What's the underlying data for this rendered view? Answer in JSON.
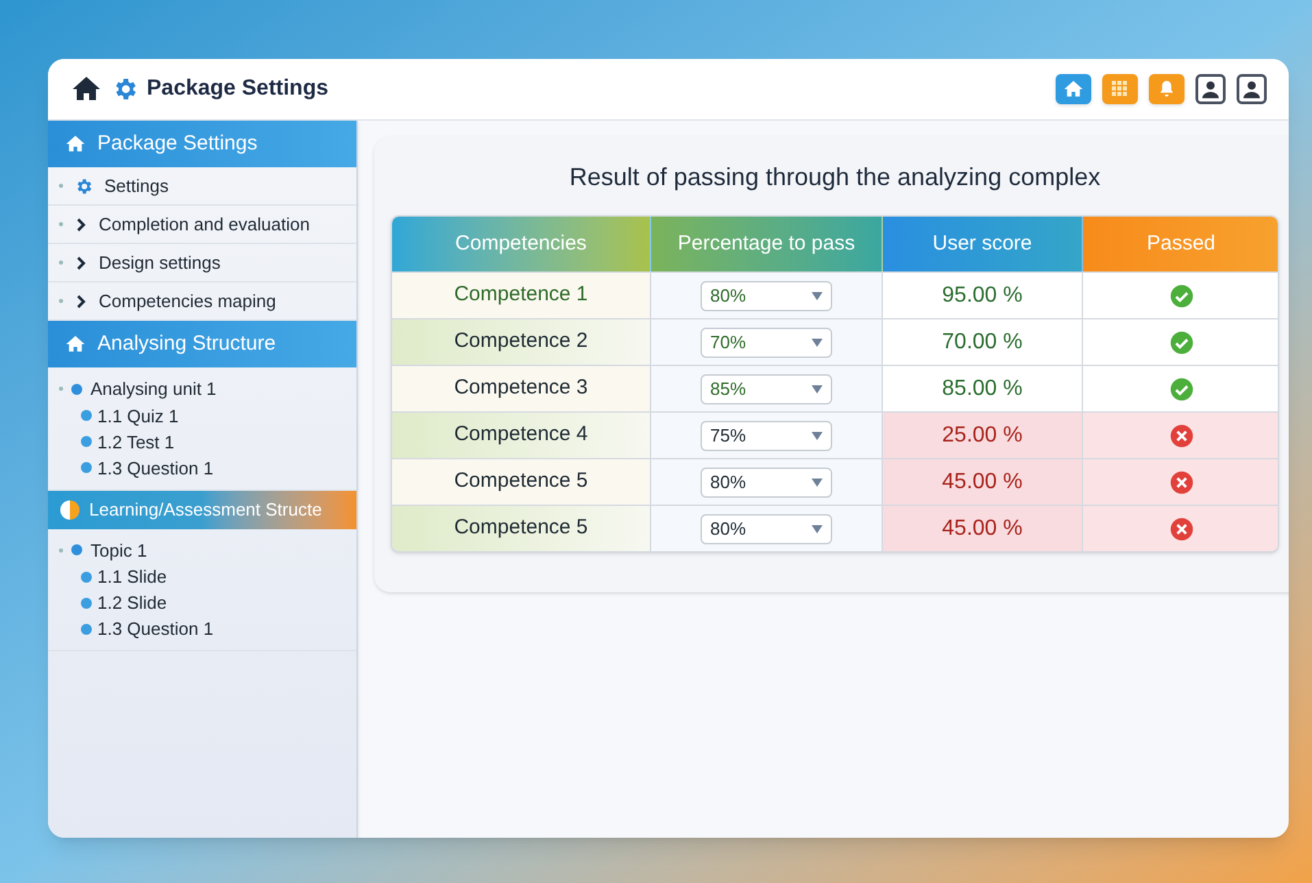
{
  "window": {
    "title": "Package Settings"
  },
  "toolbar": [
    {
      "kind": "home"
    },
    {
      "kind": "grid"
    },
    {
      "kind": "bell"
    },
    {
      "kind": "user"
    },
    {
      "kind": "user"
    }
  ],
  "sidebar": {
    "sections": [
      {
        "title": "Package Settings",
        "kind": "home",
        "items": [
          {
            "label": "Settings",
            "kind": "settings"
          },
          {
            "label": "Completion and evaluation",
            "kind": "chevron"
          },
          {
            "label": "Design settings",
            "kind": "chevron"
          },
          {
            "label": "Competencies maping",
            "kind": "chevron"
          }
        ]
      },
      {
        "title": "Analysing Structure",
        "kind": "home",
        "items": [
          {
            "label": "Analysing unit 1",
            "kind": "tree",
            "children": [
              {
                "label": "1.1 Quiz 1"
              },
              {
                "label": "1.2 Test 1"
              },
              {
                "label": "1.3 Question 1"
              }
            ]
          }
        ]
      },
      {
        "title": "Learning/Assessment Structe",
        "kind": "learning",
        "items": [
          {
            "label": "Topic 1",
            "kind": "tree",
            "children": [
              {
                "label": "1.1 Slide"
              },
              {
                "label": "1.2 Slide"
              },
              {
                "label": "1.3 Question 1"
              }
            ]
          }
        ]
      }
    ]
  },
  "results": {
    "title": "Result of passing through the analyzing complex",
    "columns": [
      "Competencies",
      "Percentage to pass",
      "User score",
      "Passed"
    ],
    "rows": [
      {
        "competence": "Competence 1",
        "percentage": "80%",
        "score": "95.00 %",
        "passed": true
      },
      {
        "competence": "Competence 2",
        "percentage": "70%",
        "score": "70.00 %",
        "passed": true
      },
      {
        "competence": "Competence 3",
        "percentage": "85%",
        "score": "85.00 %",
        "passed": true
      },
      {
        "competence": "Competence 4",
        "percentage": "75%",
        "score": "25.00 %",
        "passed": false
      },
      {
        "competence": "Competence 5",
        "percentage": "80%",
        "score": "45.00 %",
        "passed": false
      },
      {
        "competence": "Competence 5",
        "percentage": "80%",
        "score": "45.00 %",
        "passed": false
      }
    ]
  }
}
